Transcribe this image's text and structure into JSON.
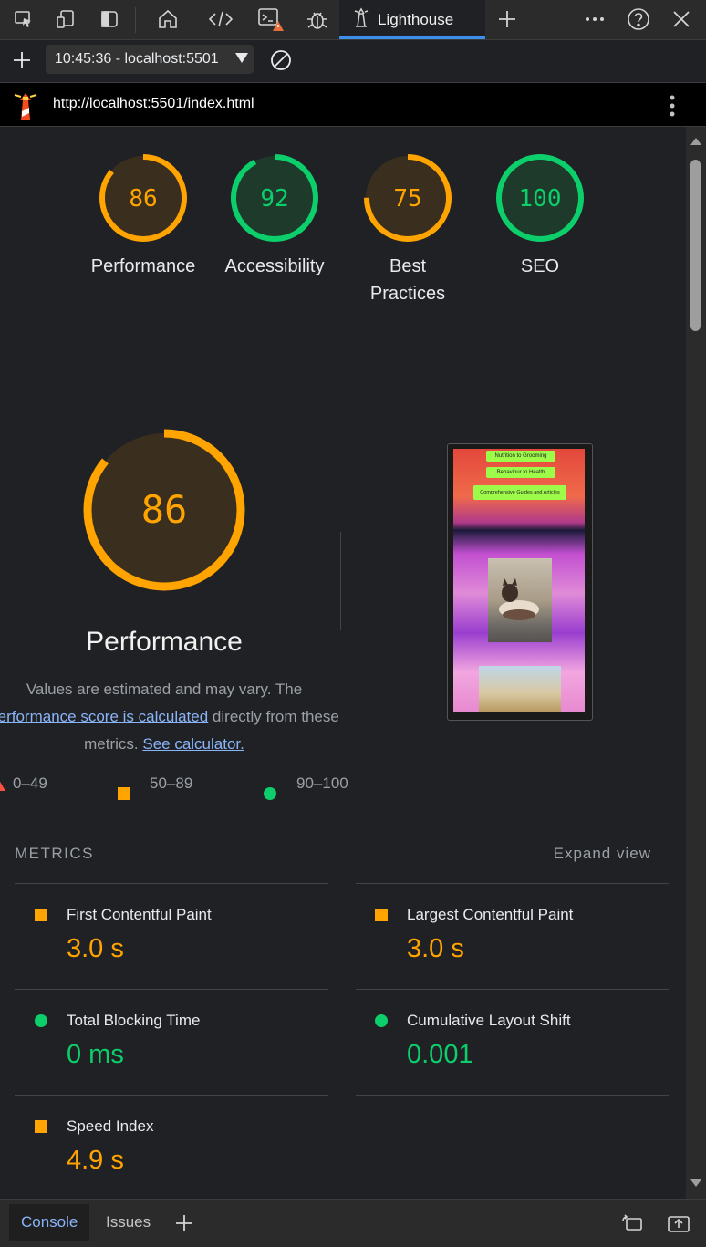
{
  "toolbar": {
    "active_tab_label": "Lighthouse"
  },
  "session": {
    "selected_report": "10:45:36 - localhost:5501"
  },
  "report": {
    "url": "http://localhost:5501/index.html"
  },
  "gauges": [
    {
      "score": "86",
      "label": "Performance",
      "color": "#ffa400"
    },
    {
      "score": "92",
      "label": "Accessibility",
      "color": "#0cce6b"
    },
    {
      "score": "75",
      "label": "Best Practices",
      "color": "#ffa400"
    },
    {
      "score": "100",
      "label": "SEO",
      "color": "#0cce6b"
    }
  ],
  "performance": {
    "score": "86",
    "title": "Performance",
    "desc_prefix": "Values are estimated and may vary. The ",
    "desc_link": "performance score is calculated",
    "desc_middle": " directly from these metrics. ",
    "calc_link": "See calculator."
  },
  "thumbnail": {
    "buttons": [
      "Nutrition to Grooming",
      "Behaviour to Health",
      "Comprehensive Guides and Articles"
    ]
  },
  "legend": [
    "0–49",
    "50–89",
    "90–100"
  ],
  "metrics": {
    "heading": "METRICS",
    "expand_label": "Expand view",
    "items": [
      {
        "name": "First Contentful Paint",
        "value": "3.0 s",
        "rating": "average"
      },
      {
        "name": "Largest Contentful Paint",
        "value": "3.0 s",
        "rating": "average"
      },
      {
        "name": "Total Blocking Time",
        "value": "0 ms",
        "rating": "pass"
      },
      {
        "name": "Cumulative Layout Shift",
        "value": "0.001",
        "rating": "pass"
      },
      {
        "name": "Speed Index",
        "value": "4.9 s",
        "rating": "average"
      }
    ]
  },
  "drawer": {
    "tabs": [
      "Console",
      "Issues"
    ]
  },
  "colors": {
    "average": "#ffa400",
    "pass": "#0cce6b",
    "link": "#8ab4f8"
  }
}
